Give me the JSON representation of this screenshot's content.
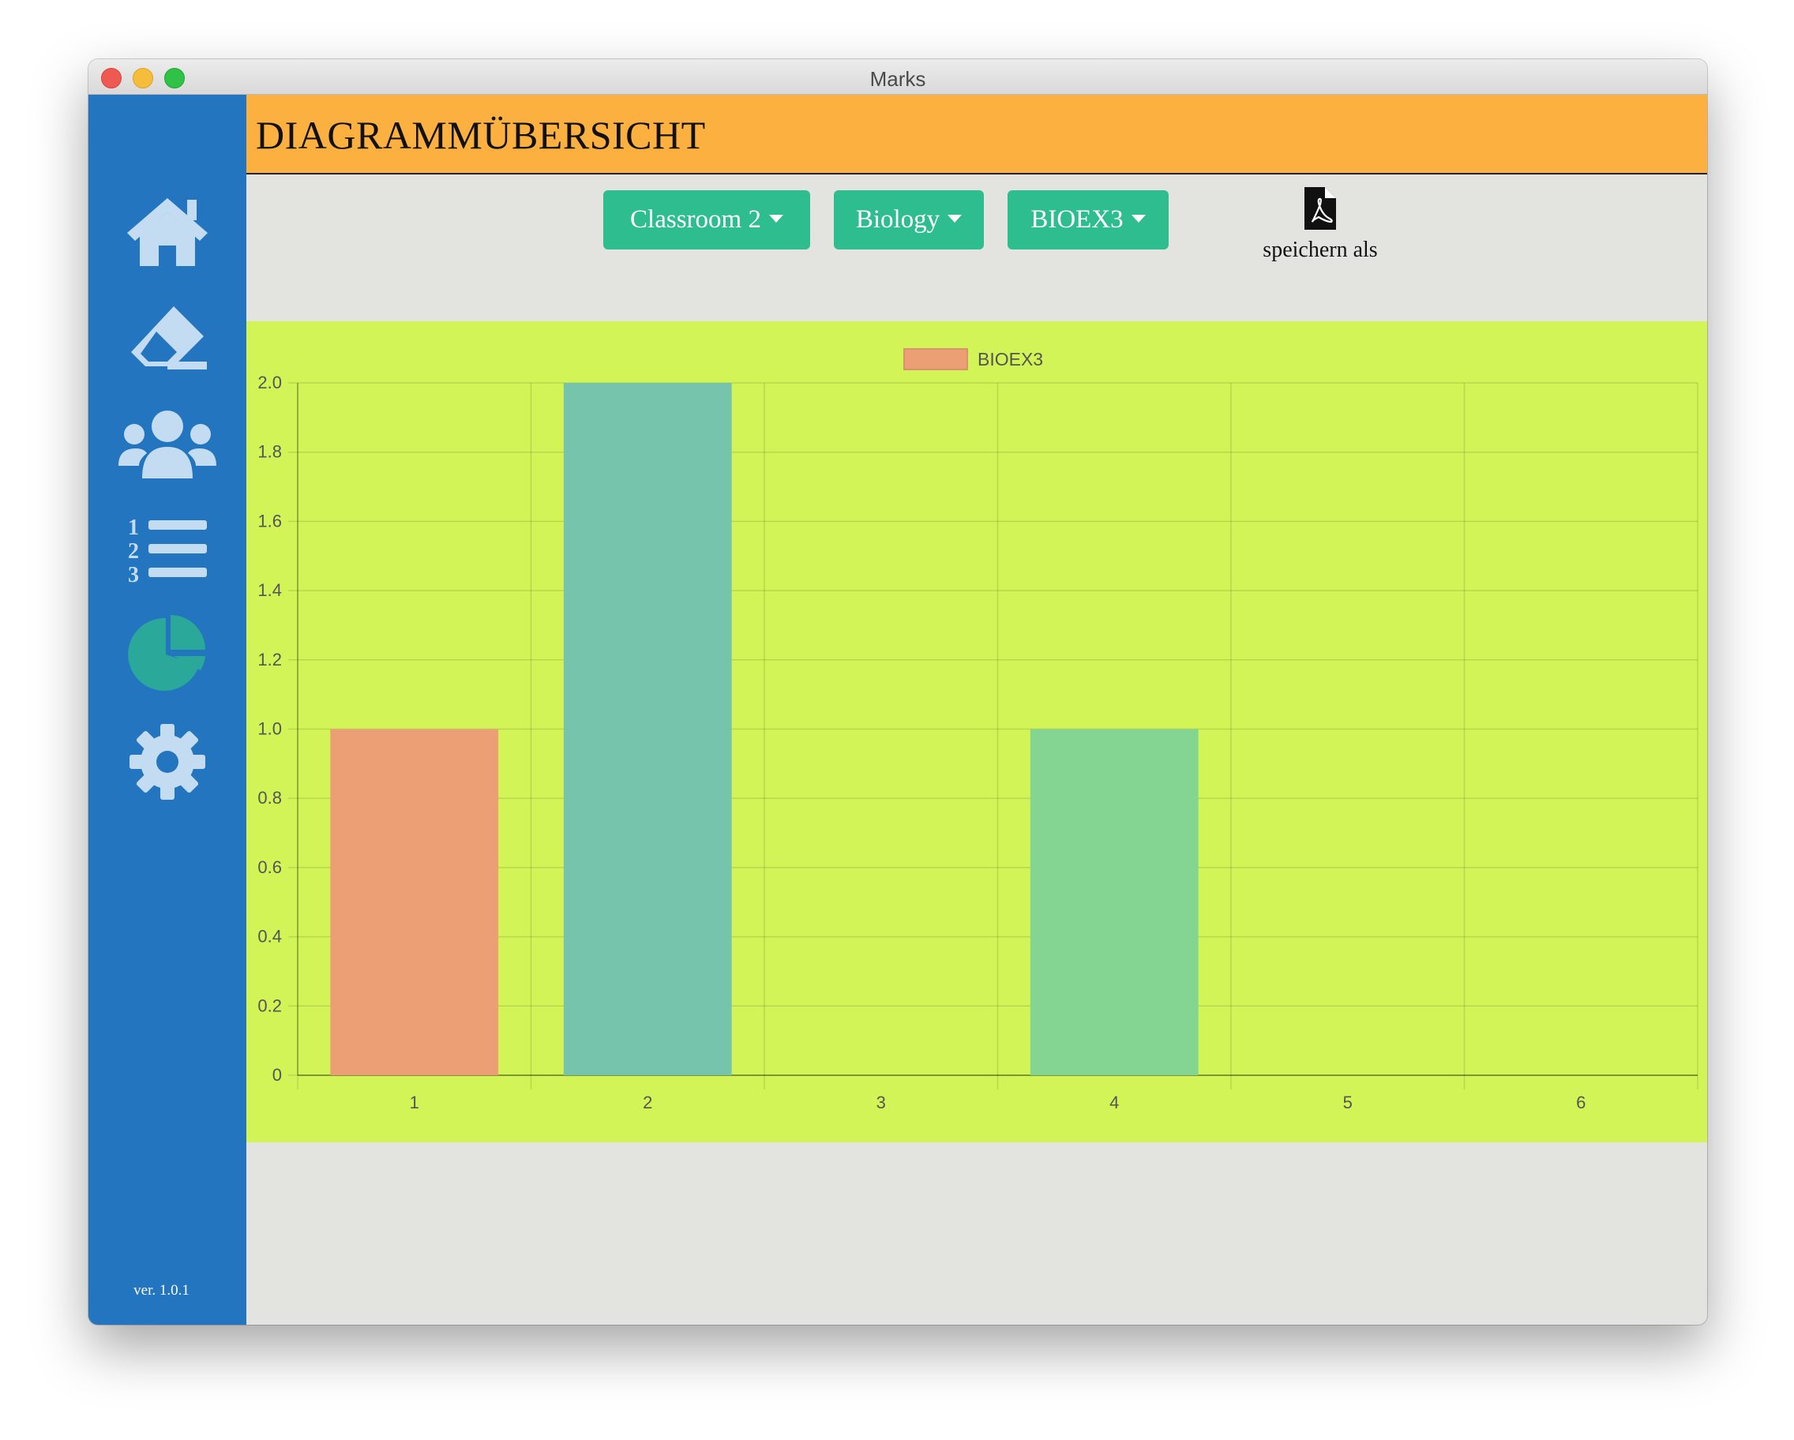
{
  "window": {
    "title": "Marks"
  },
  "sidebar": {
    "items": [
      {
        "name": "home",
        "icon": "home-icon"
      },
      {
        "name": "marks",
        "icon": "eraser-icon"
      },
      {
        "name": "students",
        "icon": "users-icon"
      },
      {
        "name": "lists",
        "icon": "numbered-list-icon"
      },
      {
        "name": "charts",
        "icon": "pie-chart-icon",
        "active": true
      },
      {
        "name": "settings",
        "icon": "gear-icon"
      }
    ],
    "version": "ver. 1.0.1"
  },
  "header": {
    "title": "DIAGRAMMÜBERSICHT"
  },
  "toolbar": {
    "classroom": "Classroom 2",
    "subject": "Biology",
    "exam": "BIOEX3",
    "export_label": "speichern als",
    "export_icon": "pdf-file-icon"
  },
  "colors": {
    "sidebar": "#2275be",
    "header": "#fbb040",
    "button": "#2ebd8e",
    "chart_bg": "#d3f457",
    "active_icon": "#2aa99b",
    "icon": "#c4dcf2"
  },
  "chart_data": {
    "type": "bar",
    "categories": [
      "1",
      "2",
      "3",
      "4",
      "5",
      "6"
    ],
    "series": [
      {
        "name": "BIOEX3",
        "values": [
          1,
          2,
          0,
          1,
          0,
          0
        ]
      }
    ],
    "bar_colors": [
      "#ec9f74",
      "#77c4ac",
      "#ec9f74",
      "#83d591",
      "#ec9f74",
      "#ec9f74"
    ],
    "yticks": [
      "0",
      "0.2",
      "0.4",
      "0.6",
      "0.8",
      "1.0",
      "1.2",
      "1.4",
      "1.6",
      "1.8",
      "2.0"
    ],
    "ylim": [
      0,
      2
    ],
    "grid": true,
    "legend": "top-center"
  }
}
